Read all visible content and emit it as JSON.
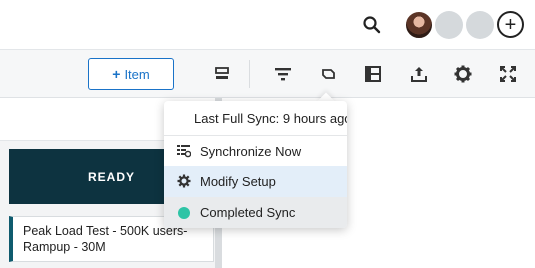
{
  "header": {
    "search_icon": "search-icon",
    "add_icon": "plus-circle-icon",
    "add_glyph": "+"
  },
  "toolbar": {
    "add_item_label": "Item",
    "add_item_plus": "+",
    "icons": [
      "columns-toggle-icon",
      "filter-icon",
      "sync-icon",
      "layout-icon",
      "export-icon",
      "settings-icon",
      "fullscreen-icon"
    ]
  },
  "board": {
    "lane_title": "READY",
    "cards": [
      {
        "title": "Peak Load Test - 500K users- Rampup - 30M"
      }
    ]
  },
  "sync_menu": {
    "last_sync": "Last Full Sync: 9 hours ago",
    "items": [
      {
        "label": "Synchronize Now",
        "icon": "sync-list-icon"
      },
      {
        "label": "Modify Setup",
        "icon": "gear-icon"
      },
      {
        "label": "Completed Sync",
        "icon": "status-dot"
      }
    ],
    "status_color": "#2ec4a6",
    "accent_color": "#1a73c8"
  }
}
